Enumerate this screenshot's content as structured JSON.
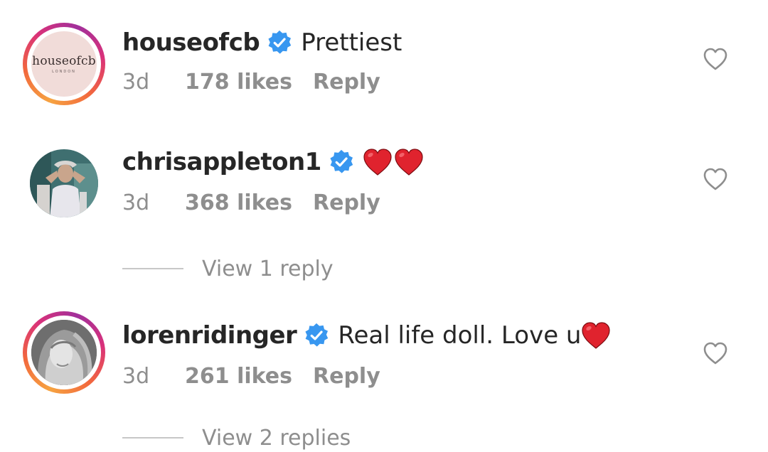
{
  "comments": [
    {
      "username": "houseofcb",
      "text": "Prettiest",
      "avatar_text": "houseofcb",
      "avatar_subtext": "LONDON",
      "time": "3d",
      "likes": "178 likes",
      "reply": "Reply"
    },
    {
      "username": "chrisappleton1",
      "text": "",
      "time": "3d",
      "likes": "368 likes",
      "reply": "Reply"
    },
    {
      "username": "lorenridinger",
      "text": "Real life doll. Love u",
      "time": "3d",
      "likes": "261 likes",
      "reply": "Reply"
    }
  ],
  "view_replies_1": "View 1 reply",
  "view_replies_2": "View 2 replies",
  "colors": {
    "verified": "#3897f0",
    "heart_emoji": "#e0232e",
    "muted": "#8e8e8e",
    "text": "#262626"
  },
  "icons": [
    "verified-badge-icon",
    "heart-outline-icon",
    "red-heart-emoji"
  ]
}
